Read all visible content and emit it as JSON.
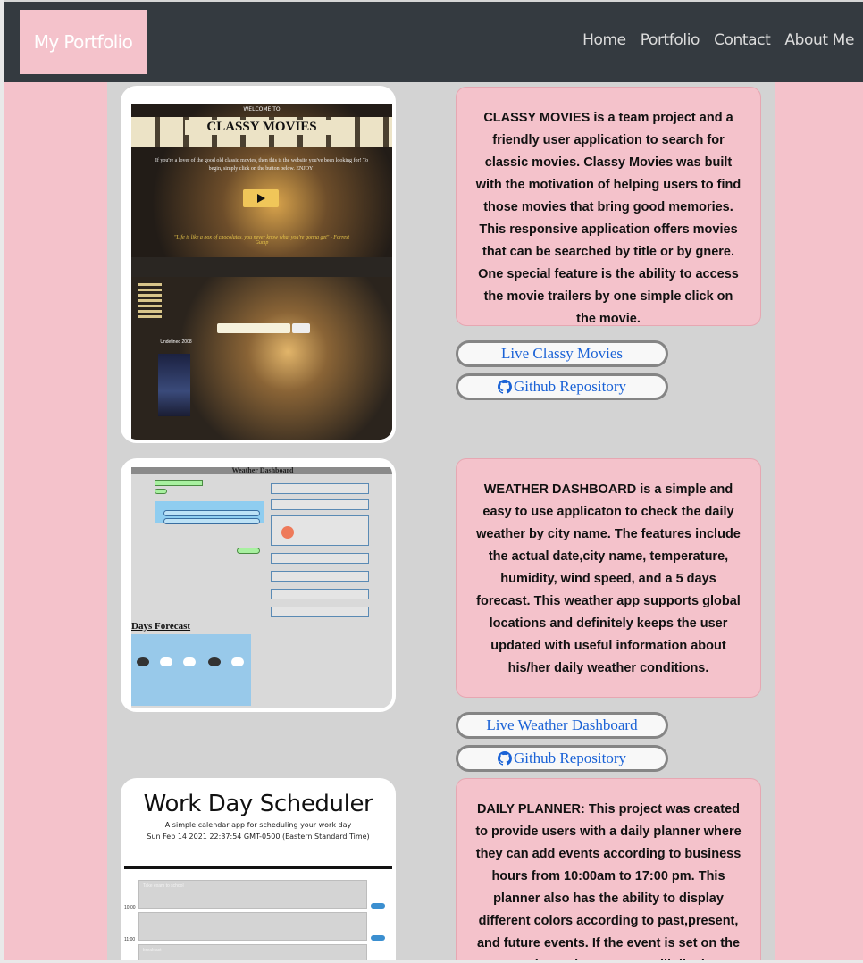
{
  "navbar": {
    "brand": "My Portfolio",
    "links": [
      "Home",
      "Portfolio",
      "Contact",
      "About Me"
    ]
  },
  "projects": [
    {
      "description": "CLASSY MOVIES is a team project and a friendly user application to search for classic movies. Classy Movies was built with the motivation of helping users to find those movies that bring good memories. This responsive application offers movies that can be searched by title or by gnere. One special feature is the ability to access the movie trailers by one simple click on the movie.",
      "live_label": "Live Classy Movies",
      "repo_label": "Github Repository",
      "preview": {
        "welcome": "WELCOME TO",
        "title": "CLASSY MOVIES",
        "subtitle": "If you're a lover of the good old classic movies, then this is the website you've been looking for! To begin, simply click on the button below. ENJOY!",
        "quote": "\"Life is like a box of chocolates, you never know what you're gonna get\" - Forrest Gump",
        "poster_label": "Undefined 2008",
        "search_button": "search"
      }
    },
    {
      "description": "WEATHER DASHBOARD is a simple and easy to use applicaton to check the daily weather by city name. The features include the actual date,city name, temperature, humidity, wind speed, and a 5 days forecast. This weather app supports global locations and definitely keeps the user updated with useful information about his/her daily weather conditions.",
      "live_label": "Live Weather Dashboard",
      "repo_label": "Github Repository",
      "preview": {
        "title": "Weather Dashboard",
        "forecast_heading": "Days Forecast"
      }
    },
    {
      "description": "DAILY PLANNER: This project was created to provide users with a daily planner where they can add events according to business hours from 10:00am to 17:00 pm. This planner also has the ability to display different colors according to past,present, and future events. If the event is set on the current hour, the text area will display a pink color. If the event",
      "preview": {
        "title": "Work Day Scheduler",
        "subtitle": "A simple calendar app for scheduling your work day",
        "date": "Sun Feb 14 2021 22:37:54 GMT-0500 (Eastern Standard Time)",
        "hours": [
          "10:00",
          "11:00"
        ],
        "row_placeholder": "Take exam to school",
        "row3_text": "breakfast",
        "save_label": "save"
      }
    }
  ],
  "colors": {
    "page_background": "#f4c2cb",
    "navbar": "#343a40",
    "content_panel": "#d3d3d3",
    "link": "#1a62d6"
  }
}
